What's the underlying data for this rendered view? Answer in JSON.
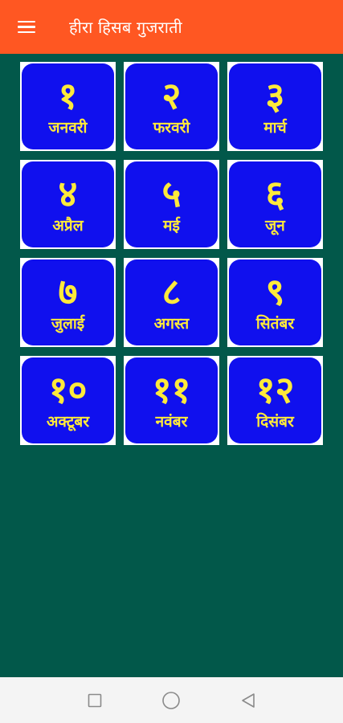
{
  "appbar": {
    "title": "हीरा हिसब गुजराती",
    "menu_icon": "hamburger-menu-icon",
    "background": "#ff5722"
  },
  "months": [
    {
      "num": "१",
      "name": "जनवरी"
    },
    {
      "num": "२",
      "name": "फरवरी"
    },
    {
      "num": "३",
      "name": "मार्च"
    },
    {
      "num": "४",
      "name": "अप्रैल"
    },
    {
      "num": "५",
      "name": "मई"
    },
    {
      "num": "६",
      "name": "जून"
    },
    {
      "num": "७",
      "name": "जुलाई"
    },
    {
      "num": "८",
      "name": "अगस्त"
    },
    {
      "num": "९",
      "name": "सितंबर"
    },
    {
      "num": "१०",
      "name": "अक्टूबर"
    },
    {
      "num": "११",
      "name": "नवंबर"
    },
    {
      "num": "१२",
      "name": "दिसंबर"
    }
  ],
  "colors": {
    "page_background": "#02584a",
    "tile_background": "#1010ee",
    "tile_text": "#ffea3b",
    "tile_border": "#ffffff"
  },
  "navbar": {
    "icons": [
      "recent-apps-icon",
      "home-icon",
      "back-icon"
    ]
  }
}
